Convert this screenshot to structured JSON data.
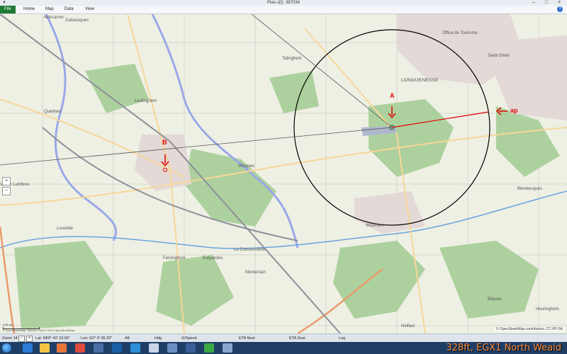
{
  "window": {
    "title": "Plan-J(I): 387034",
    "quick_access": "▼",
    "controls": [
      "–",
      "□",
      "×"
    ]
  },
  "ribbon": {
    "tabs": [
      "File",
      "Home",
      "Map",
      "Data",
      "View"
    ],
    "help": "?"
  },
  "map": {
    "markers": {
      "a": "A",
      "b": "B",
      "ap": "ap"
    },
    "labels": {
      "noircarme": "Noircarme",
      "zudausques": "Zudausques",
      "tatinghem": "Tatinghem",
      "leulinghem": "Leulinghem",
      "quelmes": "Quelmes",
      "wisques": "Wisques",
      "longuenesse": "LONGUENESSE",
      "office_tourisme": "Office de Tourisme",
      "saint_omer": "Saint-Omer",
      "wizernes": "Wizernes",
      "blendecques": "Blendecques",
      "esquerdes": "Esquerdes",
      "helfaut": "Helfaut",
      "lumbres": "Val de Lumbres",
      "louvette": "Louvette",
      "fersinghem": "Fersinghem",
      "monteclain": "Monteclain",
      "bilques": "Bilques",
      "heuringhem": "Heuringhem",
      "la_cressonniere": "La Cressonnière"
    },
    "attribution": "© OpenStreetMap contributors, CC-BY-SA",
    "scale_label": "0.85 nm",
    "credit": "© OpenStreetMap, Stamen Tiles © 2013 OpenStreetMap",
    "tools": [
      "+",
      "−"
    ]
  },
  "status": {
    "zoom_label": "Zoom 14",
    "zoom_minus": "−",
    "zoom_plus": "+",
    "lat": "Lat: N50° 42' 23.65\"",
    "lon": "Lon: E2° 9' 36.29\"",
    "alt": "Alt",
    "hdg": "Hdg",
    "gspeed": "G/Speed",
    "eta_next": "ETA Next",
    "eta_dest": "ETA Dest",
    "leg": "Leg"
  },
  "overlay": {
    "text": "328ft, EGX1 North Weald"
  },
  "colors": {
    "route_red": "#e00000",
    "circle": "#000000",
    "forest": "#add19e",
    "water_blue": "#9aa8e8",
    "taskbar": "#1e3e66",
    "overlay_text": "#ff8c3a"
  }
}
